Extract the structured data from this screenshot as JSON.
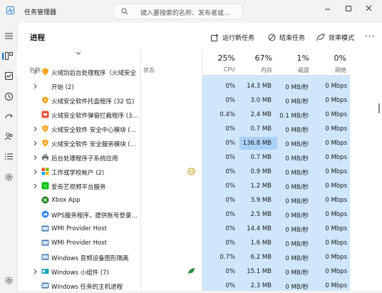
{
  "window": {
    "title": "任务管理器",
    "search_placeholder": "键入要搜索的名称、发布者或..."
  },
  "toolbar": {
    "page_title": "进程",
    "run_task": "运行新任务",
    "end_task": "结束任务",
    "efficiency": "效率模式",
    "more": "···"
  },
  "columns": {
    "name": "名称",
    "status": "状态",
    "cpu_pct": "25%",
    "cpu": "CPU",
    "mem_pct": "67%",
    "mem": "内存",
    "disk_pct": "1%",
    "disk": "磁盘",
    "net_pct": "0%",
    "net": "网络"
  },
  "rows": [
    {
      "name": "火绒剑后台处理程序（火绒安全",
      "expand": true,
      "icon": "huorong-icon",
      "cpu": "",
      "mem": "",
      "disk": "",
      "net": ""
    },
    {
      "name": "开始 (2)",
      "expand": true,
      "icon": "none",
      "cpu": "0%",
      "mem": "14.3 MB",
      "disk": "0 MB/秒",
      "net": "0 Mbps"
    },
    {
      "name": "火绒安全软件托盘程序 (32 位)",
      "expand": false,
      "icon": "huorong-shield-icon",
      "cpu": "0%",
      "mem": "3.0 MB",
      "disk": "0 MB/秒",
      "net": "0 Mbps"
    },
    {
      "name": "火绒安全软件弹窗拦截程序 (3...",
      "expand": false,
      "icon": "huorong-popup-icon",
      "cpu": "0.4%",
      "mem": "2.4 MB",
      "disk": "0.1 MB/秒",
      "net": "0 Mbps"
    },
    {
      "name": "火绒安全软件 安全中心模块 (...",
      "expand": true,
      "icon": "huorong-shield-icon",
      "cpu": "0%",
      "mem": "0.7 MB",
      "disk": "0 MB/秒",
      "net": "0 Mbps"
    },
    {
      "name": "火绒安全软件 安全服务模块 (...",
      "expand": true,
      "icon": "huorong-shield-icon",
      "cpu": "0%",
      "mem": "136.8 MB",
      "disk": "0 MB/秒",
      "net": "0 Mbps"
    },
    {
      "name": "后台处理程序子系统应用",
      "expand": true,
      "icon": "printer-icon",
      "cpu": "0%",
      "mem": "0.7 MB",
      "disk": "0 MB/秒",
      "net": "0 Mbps"
    },
    {
      "name": "工作或学校帐户 (2)",
      "expand": true,
      "icon": "windows-grid-icon",
      "cpu": "0%",
      "mem": "0.9 MB",
      "disk": "0 MB/秒",
      "net": "0 Mbps"
    },
    {
      "name": "爱奇艺视频平台服务",
      "expand": true,
      "icon": "iqiyi-icon",
      "cpu": "0%",
      "mem": "1.2 MB",
      "disk": "0 MB/秒",
      "net": "0 Mbps"
    },
    {
      "name": "Xbox App",
      "expand": false,
      "icon": "xbox-icon",
      "cpu": "0%",
      "mem": "3.9 MB",
      "disk": "0 MB/秒",
      "net": "0 Mbps"
    },
    {
      "name": "WPS服务程序，提供账号登录...",
      "expand": false,
      "icon": "wps-cloud-icon",
      "cpu": "0%",
      "mem": "2.5 MB",
      "disk": "0 MB/秒",
      "net": "0 Mbps"
    },
    {
      "name": "WMI Provider Host",
      "expand": false,
      "icon": "wmi-icon",
      "cpu": "0%",
      "mem": "14.4 MB",
      "disk": "0 MB/秒",
      "net": "0 Mbps"
    },
    {
      "name": "WMI Provider Host",
      "expand": false,
      "icon": "wmi-icon",
      "cpu": "0%",
      "mem": "1.6 MB",
      "disk": "0 MB/秒",
      "net": "0 Mbps"
    },
    {
      "name": "Windows 音频设备图形隔离",
      "expand": false,
      "icon": "wmi-icon",
      "cpu": "0.7%",
      "mem": "6.2 MB",
      "disk": "0 MB/秒",
      "net": "0 Mbps"
    },
    {
      "name": "Windows 小组件 (7)",
      "expand": true,
      "icon": "widgets-icon",
      "cpu": "0%",
      "mem": "15.1 MB",
      "disk": "0 MB/秒",
      "net": "0 Mbps"
    },
    {
      "name": "Windows 任务的主机进程",
      "expand": false,
      "icon": "wmi-icon",
      "cpu": "0%",
      "mem": "2.3 MB",
      "disk": "0 MB/秒",
      "net": "0 Mbps"
    }
  ],
  "colors": {
    "accent": "#0067c0",
    "column_highlight": "#cfe6fb",
    "row_highlight": "#a9d1f7",
    "huorong": "#f5a623",
    "huorong_red": "#e8533a"
  }
}
